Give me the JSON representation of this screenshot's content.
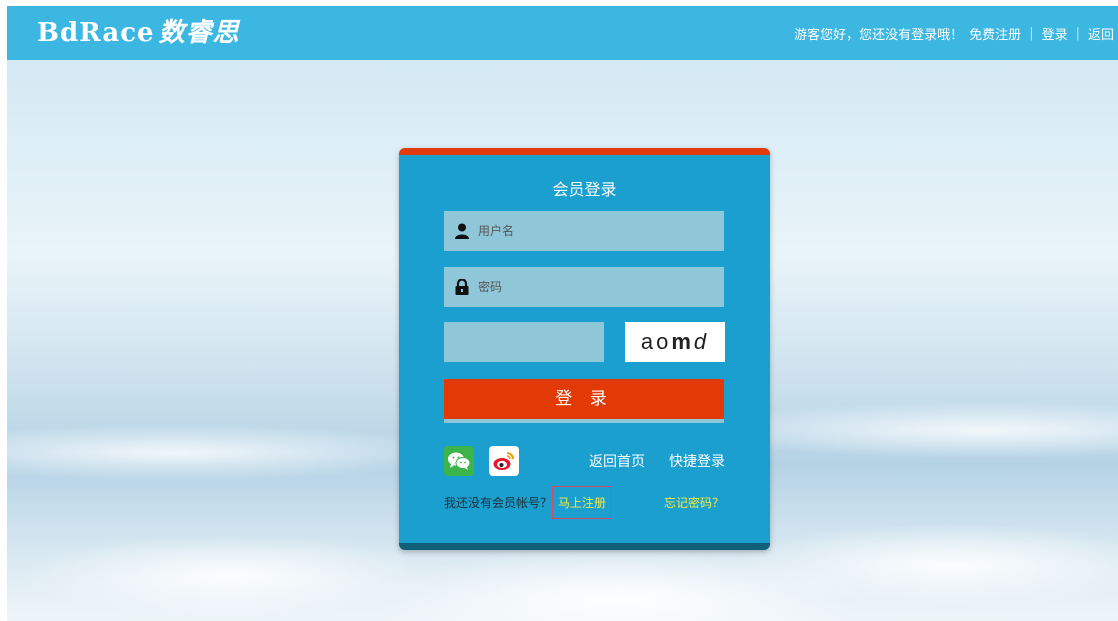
{
  "header": {
    "logo_latin": "BdRace",
    "logo_cn": "数睿思",
    "greeting": "游客您好，您还没有登录哦！",
    "register": "免费注册",
    "login": "登录",
    "back": "返回"
  },
  "login": {
    "title": "会员登录",
    "username_placeholder": "用户名",
    "password_placeholder": "密码",
    "captcha_value": "",
    "captcha": {
      "c1": "a",
      "c2": "o",
      "c3": "m",
      "c4": "d"
    },
    "submit": "登 录",
    "home_link": "返回首页",
    "quick_login": "快捷登录",
    "no_account": "我还没有会员帐号？",
    "register_now": "马上注册",
    "forgot": "忘记密码？"
  },
  "colors": {
    "header": "#3bb7e2",
    "card": "#1a9fcf",
    "accent": "#e23a06",
    "link_yellow": "#f6ea42"
  },
  "icons": [
    "user-icon",
    "lock-icon",
    "wechat-icon",
    "weibo-icon"
  ]
}
